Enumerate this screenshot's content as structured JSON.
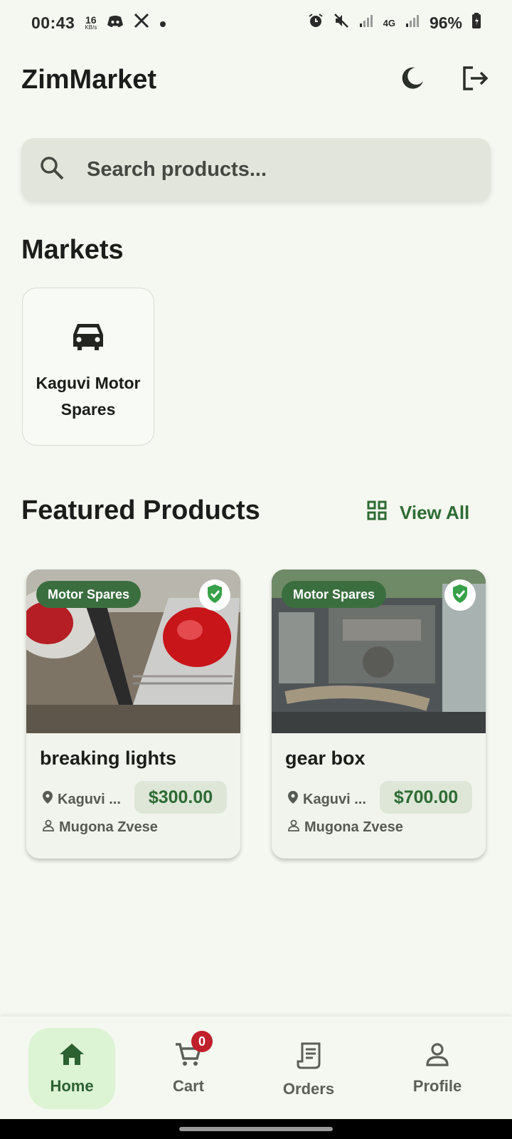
{
  "status_bar": {
    "time": "00:43",
    "net_speed_value": "16",
    "net_speed_unit": "KB/s",
    "network_type": "4G",
    "battery": "96%"
  },
  "app_bar": {
    "title": "ZimMarket"
  },
  "search": {
    "placeholder": "Search products..."
  },
  "markets": {
    "title": "Markets",
    "items": [
      {
        "name": "Kaguvi Motor Spares",
        "icon": "car-icon"
      }
    ]
  },
  "featured": {
    "title": "Featured Products",
    "view_all_label": "View All",
    "products": [
      {
        "name": "breaking lights",
        "category": "Motor Spares",
        "location": "Kaguvi ...",
        "price": "$300.00",
        "seller": "Mugona Zvese",
        "verified": true
      },
      {
        "name": "gear box",
        "category": "Motor Spares",
        "location": "Kaguvi ...",
        "price": "$700.00",
        "seller": "Mugona Zvese",
        "verified": true
      }
    ]
  },
  "bottom_nav": {
    "items": [
      {
        "label": "Home",
        "icon": "home-icon",
        "active": true
      },
      {
        "label": "Cart",
        "icon": "cart-icon",
        "badge": "0"
      },
      {
        "label": "Orders",
        "icon": "receipt-icon"
      },
      {
        "label": "Profile",
        "icon": "person-icon"
      }
    ]
  },
  "colors": {
    "background": "#f4f8f0",
    "accent": "#2e6b34",
    "category_badge": "#3b6e3f",
    "active_nav": "#dcf3d4",
    "cart_badge": "#c0202a"
  }
}
